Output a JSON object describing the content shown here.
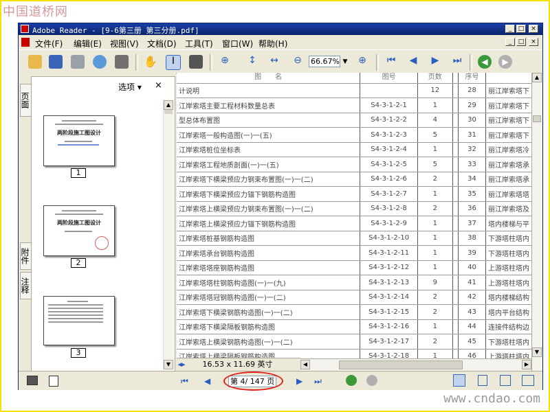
{
  "watermark_top": "中国道桥网",
  "watermark_bottom": "www.cndao.com",
  "window": {
    "title": "Adobe Reader - [9-6第三册  第三分册.pdf]",
    "controls": [
      "_",
      "□",
      "×"
    ]
  },
  "menu": [
    "文件(F)",
    "编辑(E)",
    "视图(V)",
    "文档(D)",
    "工具(T)",
    "窗口(W)",
    "帮助(H)"
  ],
  "toolbar": {
    "zoom_value": "66.67%"
  },
  "sidepanel": {
    "tabs": [
      "页面",
      "附件",
      "注释"
    ],
    "options_label": "选项 ▾",
    "close_label": "×",
    "thumbnail_title": "两阶段施工图设计",
    "thumbnails": [
      "1",
      "2",
      "3"
    ]
  },
  "table": {
    "header": {
      "name": "图　　名",
      "code": "图号",
      "pages": "页数",
      "no": "序号"
    },
    "rows": [
      {
        "name": "计说明",
        "code": "",
        "pages": "12",
        "no": "28",
        "name2": "丽江岸索塔下"
      },
      {
        "name": "江岸索塔主要工程材料数量总表",
        "code": "S4-3-1-2-1",
        "pages": "1",
        "no": "29",
        "name2": "丽江岸索塔下"
      },
      {
        "name": "型总体布置图",
        "code": "S4-3-1-2-2",
        "pages": "4",
        "no": "30",
        "name2": "丽江岸索塔下"
      },
      {
        "name": "江岸索塔一般构造图(一)一(五)",
        "code": "S4-3-1-2-3",
        "pages": "5",
        "no": "31",
        "name2": "丽江岸索塔下"
      },
      {
        "name": "江岸索塔桩位坐标表",
        "code": "S4-3-1-2-4",
        "pages": "1",
        "no": "32",
        "name2": "丽江岸索塔冷"
      },
      {
        "name": "江岸索塔工程地质剖面(一)一(五)",
        "code": "S4-3-1-2-5",
        "pages": "5",
        "no": "33",
        "name2": "丽江岸索塔承"
      },
      {
        "name": "江岸索塔下横梁预应力钢束布置图(一)一(二)",
        "code": "S4-3-1-2-6",
        "pages": "2",
        "no": "34",
        "name2": "丽江岸索塔承"
      },
      {
        "name": "江岸索塔下横梁预应力锚下钢筋构造图",
        "code": "S4-3-1-2-7",
        "pages": "1",
        "no": "35",
        "name2": "丽江岸索塔塔"
      },
      {
        "name": "江岸索塔上横梁预应力钢束布置图(一)一(二)",
        "code": "S4-3-1-2-8",
        "pages": "2",
        "no": "36",
        "name2": "丽江岸索塔及"
      },
      {
        "name": "江岸索塔上横梁预应力锚下钢筋构造图",
        "code": "S4-3-1-2-9",
        "pages": "1",
        "no": "37",
        "name2": "塔内楼梯与平"
      },
      {
        "name": "江岸索塔桩基钢筋构造图",
        "code": "S4-3-1-2-10",
        "pages": "1",
        "no": "38",
        "name2": "下游塔柱塔内"
      },
      {
        "name": "江岸索塔承台钢筋构造图",
        "code": "S4-3-1-2-11",
        "pages": "1",
        "no": "39",
        "name2": "下游塔柱塔内"
      },
      {
        "name": "江岸索塔塔座钢筋构造图",
        "code": "S4-3-1-2-12",
        "pages": "1",
        "no": "40",
        "name2": "上游塔柱塔内"
      },
      {
        "name": "江岸索塔塔柱钢筋构造图(一)一(九)",
        "code": "S4-3-1-2-13",
        "pages": "9",
        "no": "41",
        "name2": "上游塔柱塔内"
      },
      {
        "name": "江岸索塔塔冠钢筋构造图(一)一(二)",
        "code": "S4-3-1-2-14",
        "pages": "2",
        "no": "42",
        "name2": "塔内楼梯结构"
      },
      {
        "name": "江岸索塔下横梁钢筋构造图(一)一(二)",
        "code": "S4-3-1-2-15",
        "pages": "2",
        "no": "43",
        "name2": "塔内平台结构"
      },
      {
        "name": "江岸索塔下横梁隔板钢筋构造图",
        "code": "S4-3-1-2-16",
        "pages": "1",
        "no": "44",
        "name2": "连接件结构边"
      },
      {
        "name": "江岸索塔上横梁钢筋构造图(一)一(二)",
        "code": "S4-3-1-2-17",
        "pages": "2",
        "no": "45",
        "name2": "下游塔柱塔内"
      },
      {
        "name": "江岸索塔上横梁隔板钢筋构造图",
        "code": "S4-3-1-2-18",
        "pages": "1",
        "no": "46",
        "name2": "上游塔柱塔内"
      }
    ]
  },
  "page_size": "16.53 x 11.69 英寸",
  "status": {
    "page_display": "第 4/ 147 页"
  }
}
